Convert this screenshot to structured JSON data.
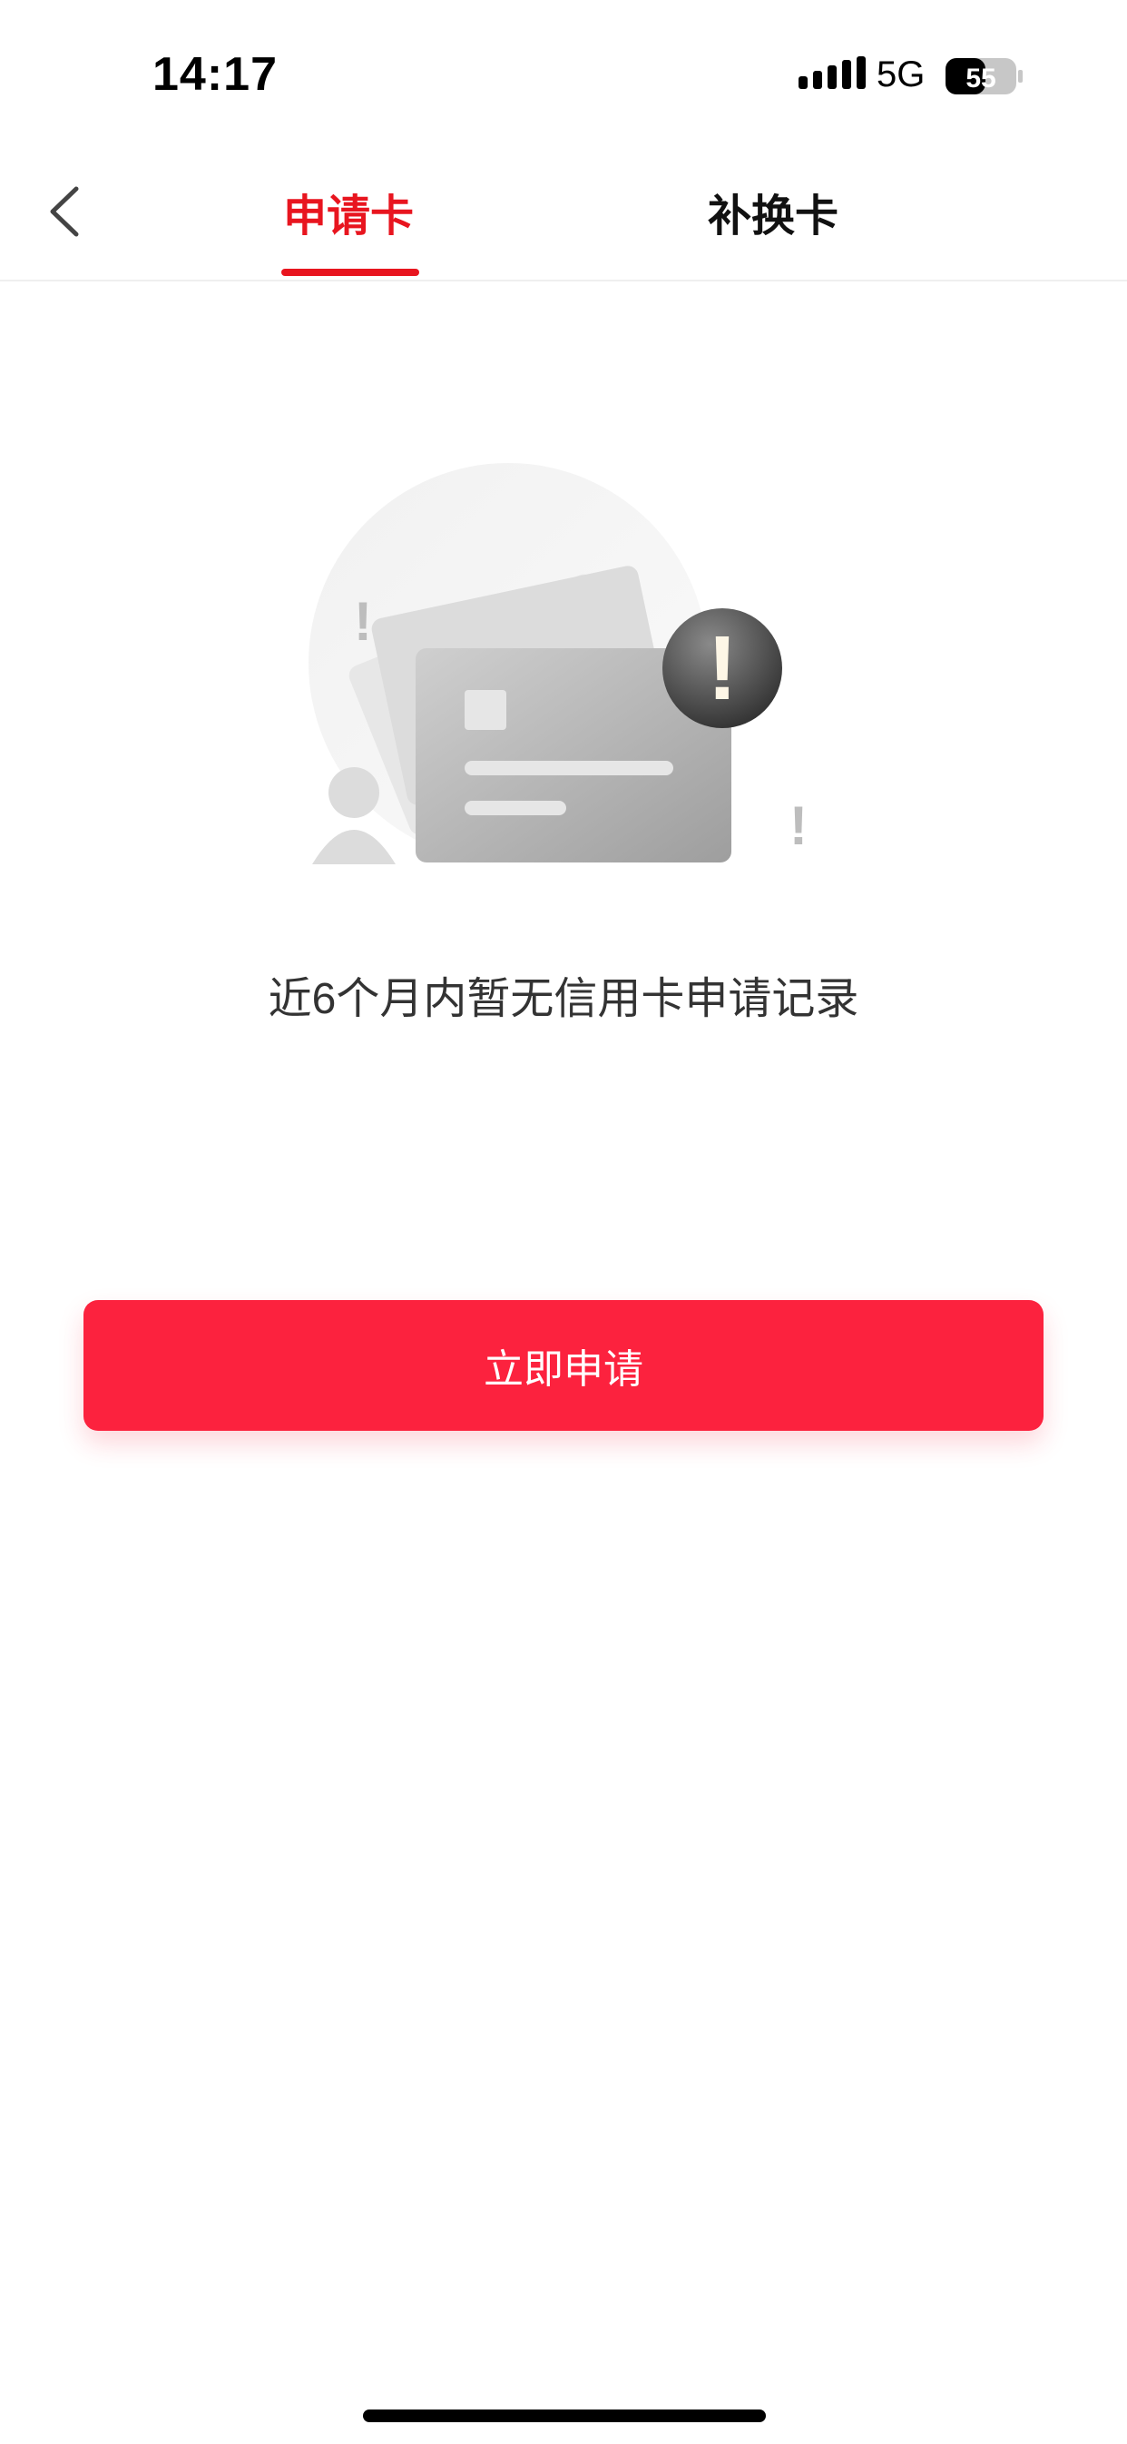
{
  "status_bar": {
    "time": "14:17",
    "network": "5G",
    "battery": "55"
  },
  "nav": {
    "back_icon": "chevron-left-icon",
    "tabs": [
      {
        "label": "申请卡",
        "active": true
      },
      {
        "label": "补换卡",
        "active": false
      }
    ]
  },
  "empty_state": {
    "illustration": "card-warning-illustration",
    "message": "近6个月内暂无信用卡申请记录"
  },
  "apply_button": {
    "label": "立即申请"
  },
  "colors": {
    "accent": "#e8151f",
    "button": "#fc223e",
    "text": "#333333",
    "divider": "#efefef"
  }
}
